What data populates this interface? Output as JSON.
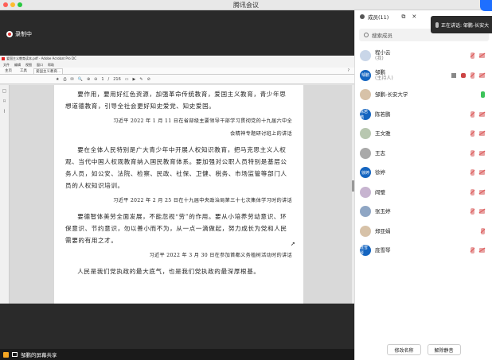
{
  "window": {
    "title": "腾讯会议"
  },
  "recording": {
    "label": "录制中"
  },
  "acrobat": {
    "title": "爱国主义教育读本.pdf - Adobe Acrobat Pro DC",
    "menu": [
      "文件",
      "编辑",
      "视图",
      "窗口",
      "帮助"
    ],
    "tabs": [
      "主页",
      "工具",
      "爱国主义教育..."
    ],
    "help": "?",
    "toolbar": [
      "★",
      "⎙",
      "✉",
      "🔍",
      "⊕",
      "⊖",
      "1",
      "/",
      "216",
      "▭",
      "▶",
      "✎",
      "⊘"
    ],
    "page": [
      {
        "kind": "body",
        "text": "要作用，要用好红色资源，加强革命传统教育，爱国主义教育，青少年思想道德教育，引导全社会更好知史爱党、知史爱国。"
      },
      {
        "kind": "cite",
        "text": "习近平 2022 年 1 月 11 日在省部级主要领导干部学习贯彻党的十九届六中全"
      },
      {
        "kind": "cite-sub",
        "text": "会精神专题研讨班上的讲话"
      },
      {
        "kind": "body",
        "text": "要在全体人民特别是广大青少年中开展人权知识教育，把马克思主义人权观、当代中国人权观教育纳入国民教育体系。要加强对公职人员特别是基层公务人员，如公安、法院、检察、民政、社保、卫健、税务、市场监管等部门人员的人权知识培训。"
      },
      {
        "kind": "cite",
        "text": "习近平 2022 年 2 月 25 日在十九届中央政治局第三十七次集体学习时的讲话"
      },
      {
        "kind": "body",
        "text": "要德智体美劳全面发展，不能忽视“劳”的作用。要从小培养劳动意识、环保意识、节约意识，勿以善小而不为，从一点一滴做起，努力成长为党和人民需要的有用之才。"
      },
      {
        "kind": "cite",
        "text": "习近平 2022 年 3 月 30 日在参加首都义务植树活动时的讲话"
      },
      {
        "kind": "body",
        "text": "人民是我们党执政的最大底气，也是我们党执政的最深厚根基。"
      }
    ]
  },
  "statusbar": {
    "label": "邹鹏的屏幕共享"
  },
  "panel": {
    "title": "成员(11)",
    "popout": "⧉",
    "close": "✕",
    "search_placeholder": "搜索成员",
    "speaking_label": "正在讲话: 邹鹏-长安大",
    "members": [
      {
        "name": "程小云",
        "sub": "(我)",
        "avatar": "photo1",
        "initials": "",
        "mic": "off",
        "cam": "off",
        "extra": ""
      },
      {
        "name": "邹鹏",
        "sub": "(主持人)",
        "avatar": "blue",
        "initials": "邹鹏",
        "mic": "off",
        "cam": "off",
        "extra": "share"
      },
      {
        "name": "邹鹏-长安大学",
        "sub": "",
        "avatar": "photo2",
        "initials": "",
        "mic": "on",
        "cam": "",
        "extra": ""
      },
      {
        "name": "陈若鹏",
        "sub": "",
        "avatar": "blue",
        "initials": "陈若鹏",
        "mic": "off",
        "cam": "off",
        "extra": ""
      },
      {
        "name": "王文雅",
        "sub": "",
        "avatar": "photo3",
        "initials": "",
        "mic": "off",
        "cam": "off",
        "extra": ""
      },
      {
        "name": "王志",
        "sub": "",
        "avatar": "photo4",
        "initials": "",
        "mic": "off",
        "cam": "off",
        "extra": ""
      },
      {
        "name": "徐婷",
        "sub": "",
        "avatar": "blue",
        "initials": "徐婷",
        "mic": "off",
        "cam": "off",
        "extra": ""
      },
      {
        "name": "阎璧",
        "sub": "",
        "avatar": "photo5",
        "initials": "",
        "mic": "off",
        "cam": "off",
        "extra": ""
      },
      {
        "name": "张玉婷",
        "sub": "",
        "avatar": "photo6",
        "initials": "",
        "mic": "off",
        "cam": "off",
        "extra": ""
      },
      {
        "name": "郑亚娟",
        "sub": "",
        "avatar": "photo2",
        "initials": "",
        "mic": "off",
        "cam": "",
        "extra": ""
      },
      {
        "name": "庞雪琴",
        "sub": "",
        "avatar": "blue",
        "initials": "庞雪琴",
        "mic": "off",
        "cam": "off",
        "extra": ""
      }
    ],
    "buttons": {
      "rename": "修改名称",
      "unmute_all": "解除静音"
    }
  },
  "colors": {
    "accent": "#1565c0",
    "recording": "#e0322f",
    "mic_on": "#3cc35a",
    "muted": "#d55555"
  }
}
